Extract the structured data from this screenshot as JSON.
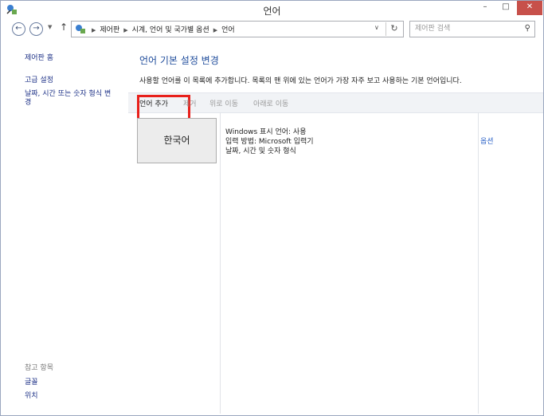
{
  "window": {
    "title": "언어",
    "minimize_glyph": "–",
    "maximize_glyph": "□",
    "close_glyph": "✕"
  },
  "address_bar": {
    "breadcrumbs": [
      "제어판",
      "시계, 언어 및 국가별 옵션",
      "언어"
    ],
    "search_placeholder": "제어판 검색"
  },
  "sidebar": {
    "home": "제어판 홈",
    "links": [
      "고급 설정",
      "날짜, 시간 또는 숫자 형식 변",
      "경"
    ],
    "see_also_heading": "참고 항목",
    "see_also": [
      "글꼴",
      "위치"
    ]
  },
  "main": {
    "title": "언어 기본 설정 변경",
    "description": "사용할 언어를 이 목록에 추가합니다. 목록의 맨 위에 있는 언어가 가장 자주 보고 사용하는 기본 언어입니다.",
    "toolbar": {
      "add": "언어 추가",
      "remove": "제거",
      "move_up": "위로 이동",
      "move_down": "아래로 이동"
    },
    "languages": [
      {
        "name": "한국어",
        "details": [
          "Windows 표시 언어: 사용",
          "입력 방법: Microsoft 입력기",
          "날짜, 시간 및 숫자 형식"
        ],
        "options_link": "옵션"
      }
    ]
  },
  "colors": {
    "link": "#1e3287",
    "title": "#1e4b9b",
    "highlight_box": "#e8201b",
    "close_button": "#c7504a"
  },
  "icons": [
    "control-panel-icon",
    "back-arrow-icon",
    "forward-arrow-icon",
    "history-dropdown-icon",
    "up-arrow-icon",
    "dropdown-icon",
    "refresh-icon",
    "search-icon"
  ]
}
